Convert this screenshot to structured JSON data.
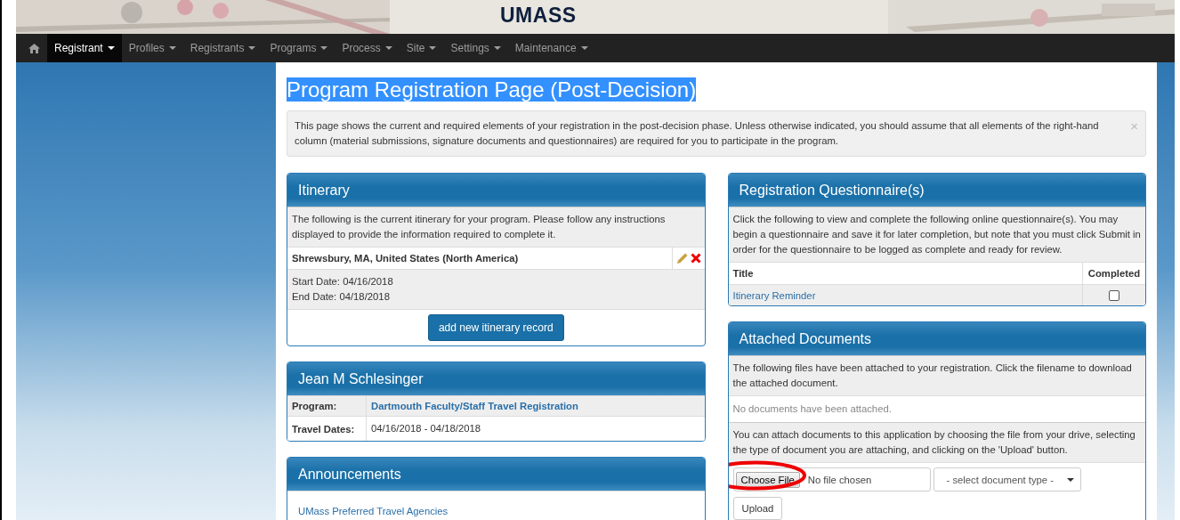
{
  "banner": {
    "logo_text": "UMASS"
  },
  "navbar": {
    "items": [
      {
        "label": "Registrant",
        "selected": true
      },
      {
        "label": "Profiles",
        "selected": false
      },
      {
        "label": "Registrants",
        "selected": false
      },
      {
        "label": "Programs",
        "selected": false
      },
      {
        "label": "Process",
        "selected": false
      },
      {
        "label": "Site",
        "selected": false
      },
      {
        "label": "Settings",
        "selected": false
      },
      {
        "label": "Maintenance",
        "selected": false
      }
    ]
  },
  "page": {
    "title": "Program Registration Page (Post-Decision)",
    "title_highlighted": true,
    "alert": {
      "text": "This page shows the current and required elements of your registration in the post-decision phase. Unless otherwise indicated, you should assume that all elements of the right-hand column (material submissions, signature documents and questionnaires) are required for you to participate in the program.",
      "close": "×"
    }
  },
  "itinerary": {
    "title": "Itinerary",
    "intro": "The following is the current itinerary for your program. Please follow any instructions displayed to provide the information required to complete it.",
    "records": [
      {
        "location": "Shrewsbury, MA, United States (North America)",
        "start": "Start Date: 04/16/2018",
        "end": "End Date: 04/18/2018"
      }
    ],
    "add_button": "add new itinerary record"
  },
  "person": {
    "title": "Jean M Schlesinger",
    "rows": [
      {
        "label": "Program:",
        "value": "Dartmouth Faculty/Staff Travel Registration",
        "kind": "link"
      },
      {
        "label": "Travel Dates:",
        "value": "04/16/2018 - 04/18/2018",
        "kind": "text"
      }
    ]
  },
  "announcements": {
    "title": "Announcements",
    "items": [
      "UMass Preferred Travel Agencies"
    ]
  },
  "questionnaires": {
    "title": "Registration Questionnaire(s)",
    "intro": "Click the following to view and complete the following online questionnaire(s). You may begin a questionnaire and save it for later completion, but note that you must click Submit in order for the questionnaire to be logged as complete and ready for review.",
    "columns": [
      "Title",
      "Completed"
    ],
    "rows": [
      {
        "title": "Itinerary Reminder",
        "completed": false
      }
    ]
  },
  "documents": {
    "title": "Attached Documents",
    "intro": "The following files have been attached to your registration. Click the filename to download the attached document.",
    "empty": "No documents have been attached.",
    "instructions": "You can attach documents to this application by choosing the file from your drive, selecting the type of document you are attaching, and clicking on the 'Upload' button.",
    "file_button": "Choose File",
    "file_status": "No file chosen",
    "type_placeholder": "- select document type -",
    "upload_button": "Upload",
    "annotated": true
  }
}
